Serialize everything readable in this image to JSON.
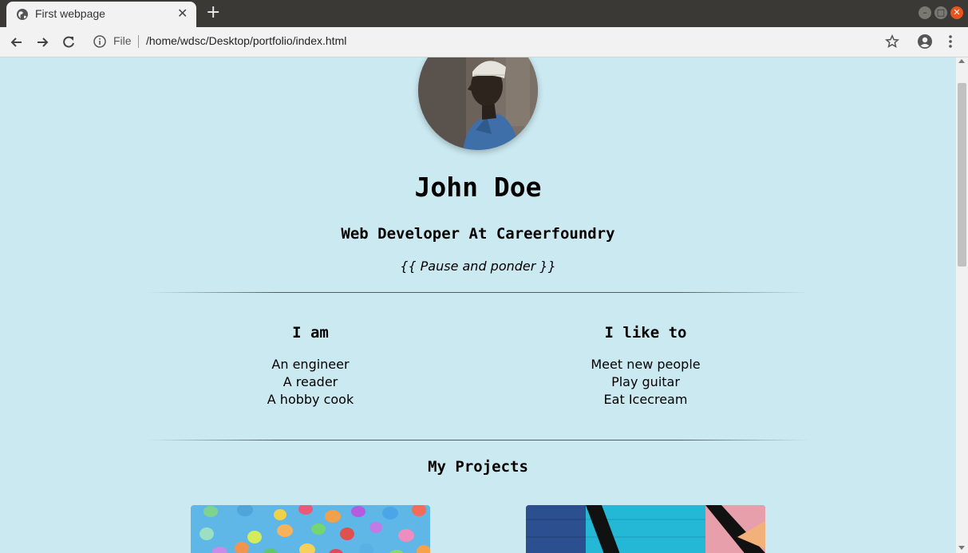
{
  "browser": {
    "tab_title": "First webpage",
    "url_scheme": "File",
    "url_path": "/home/wdsc/Desktop/portfolio/index.html"
  },
  "profile": {
    "name": "John Doe",
    "subtitle": "Web Developer At Careerfoundry",
    "quote": "{{ Pause and ponder }}"
  },
  "about": {
    "i_am_heading": "I am",
    "i_am_items": [
      "An engineer",
      "A reader",
      "A hobby cook"
    ],
    "like_heading": "I like to",
    "like_items": [
      "Meet new people",
      "Play guitar",
      "Eat Icecream"
    ]
  },
  "projects": {
    "heading": "My Projects"
  },
  "colors": {
    "page_background": "#cbe9f1",
    "tab_bar": "#3a3936",
    "window_close": "#e9541d"
  }
}
